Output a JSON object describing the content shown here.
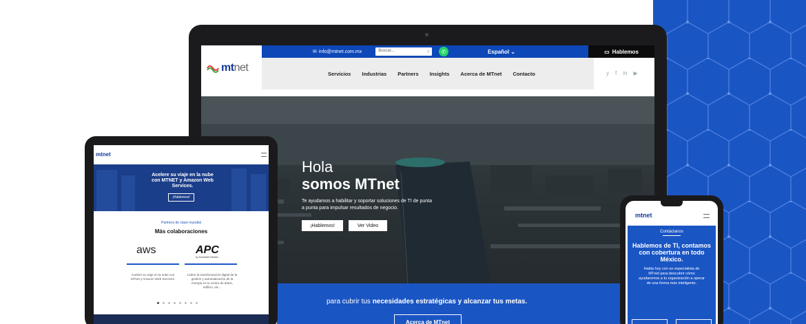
{
  "desktop": {
    "topbar": {
      "email": "info@mtnet.com.mx",
      "search_placeholder": "Buscar...",
      "language": "Español",
      "cta": "Hablemos"
    },
    "logo": {
      "brand_bold": "mt",
      "brand_light": "net"
    },
    "nav": [
      "Servicios",
      "Industrias",
      "Partners",
      "Insights",
      "Acerca de MTnet",
      "Contacto"
    ],
    "social": [
      "y",
      "f",
      "in",
      "▶"
    ],
    "hero": {
      "line1": "Hola",
      "line2": "somos MTnet",
      "text": "Te ayudamos a habilitar y soportar soluciones de TI de punta a punta para impulsar resultados de negocio.",
      "button_primary": "¡Hablemos!",
      "button_secondary": "Ver Video"
    },
    "band": {
      "text_prefix": "para cubrir tus ",
      "text_bold": "necesidades estratégicas y alcanzar tus metas.",
      "button": "Acerca de MTnet"
    }
  },
  "tablet": {
    "logo": "mtnet",
    "banner_title": "Acelere su viaje en la nube con MTNET y Amazon Web Services.",
    "banner_button": "¡Hablemos!",
    "subtitle": "Partners de clase mundial",
    "heading": "Más colaboraciones",
    "partners": [
      {
        "name": "aws",
        "desc": "Acelere su viaje en la nube con MTnet y Amazon Web Services."
      },
      {
        "name": "APC",
        "sub": "by Schneider Electric",
        "desc": "Lidere la transformación digital de la gestión y automatización de la energía en tu centro de datos, edificio, etc..."
      }
    ]
  },
  "phone": {
    "logo": "mtnet",
    "label": "Contáctanos",
    "title": "Hablemos de TI, contamos con cobertura en todo México.",
    "text": "Habla hoy con un especialista de MTnet para descubrir cómo ayudaremos a tu organización a operar de una forma más inteligente."
  },
  "colors": {
    "brand_blue": "#1a55c4",
    "dark": "#1b1b1d",
    "whatsapp": "#25d366"
  }
}
